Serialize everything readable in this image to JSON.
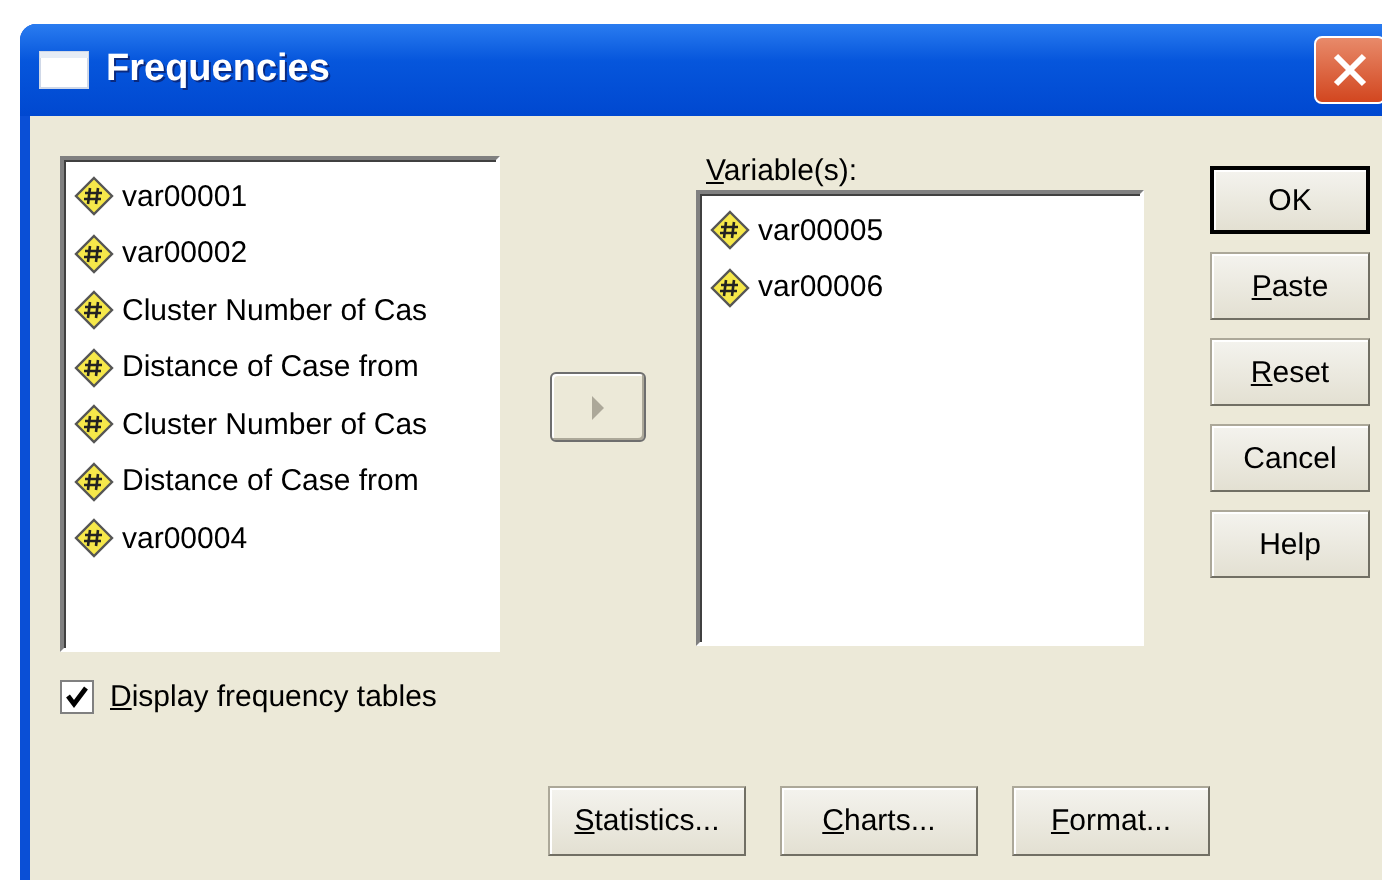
{
  "window": {
    "title": "Frequencies"
  },
  "source_list": {
    "items": [
      {
        "label": "var00001"
      },
      {
        "label": "var00002"
      },
      {
        "label": "Cluster Number of Cas"
      },
      {
        "label": "Distance of Case from"
      },
      {
        "label": "Cluster Number of Cas"
      },
      {
        "label": "Distance of Case from"
      },
      {
        "label": "var00004"
      }
    ]
  },
  "move_button": {
    "disabled": true
  },
  "variables_list": {
    "label": "Variable(s):",
    "items": [
      {
        "label": "var00005"
      },
      {
        "label": "var00006"
      }
    ]
  },
  "side_buttons": [
    {
      "label": "OK",
      "default": true,
      "mnemonic": false
    },
    {
      "label": "Paste",
      "default": false,
      "mnemonic": true
    },
    {
      "label": "Reset",
      "default": false,
      "mnemonic": true
    },
    {
      "label": "Cancel",
      "default": false,
      "mnemonic": false
    },
    {
      "label": "Help",
      "default": false,
      "mnemonic": false
    }
  ],
  "display_frequency_tables": {
    "label": "Display frequency tables",
    "checked": true
  },
  "bottom_buttons": [
    {
      "label": "Statistics..."
    },
    {
      "label": "Charts..."
    },
    {
      "label": "Format..."
    }
  ]
}
